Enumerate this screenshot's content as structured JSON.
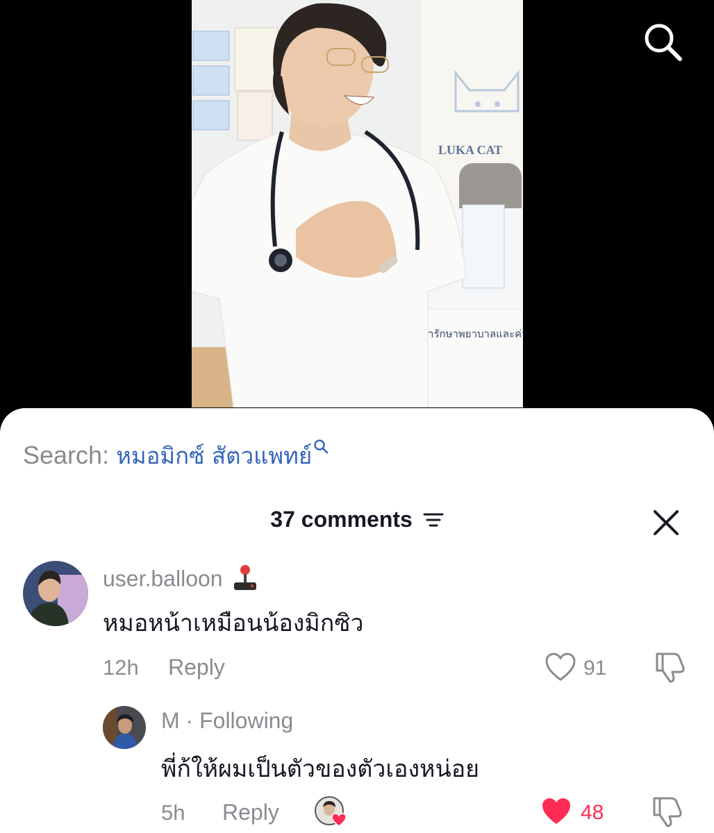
{
  "video": {
    "sign_text": "LUKA CAT",
    "board_text": "ค่ารักษาพยาบาลและค่าบ"
  },
  "search": {
    "label": "Search:",
    "query": "หมอมิกซ์ สัตวแพทย์"
  },
  "comments": {
    "count_label": "37 comments",
    "items": [
      {
        "username": "user.balloon",
        "text": "หมอหน้าเหมือนน้องมิกซิว",
        "time": "12h",
        "reply_label": "Reply",
        "likes": "91"
      },
      {
        "username": "M",
        "badge": "· Following",
        "text": "พี่ก้ให้ผมเป็นตัวของตัวเองหน่อย",
        "time": "5h",
        "reply_label": "Reply",
        "likes": "48"
      }
    ]
  },
  "colors": {
    "accent": "#fe2c55",
    "link": "#3565b8",
    "muted": "#8a8b91",
    "text": "#161823"
  }
}
